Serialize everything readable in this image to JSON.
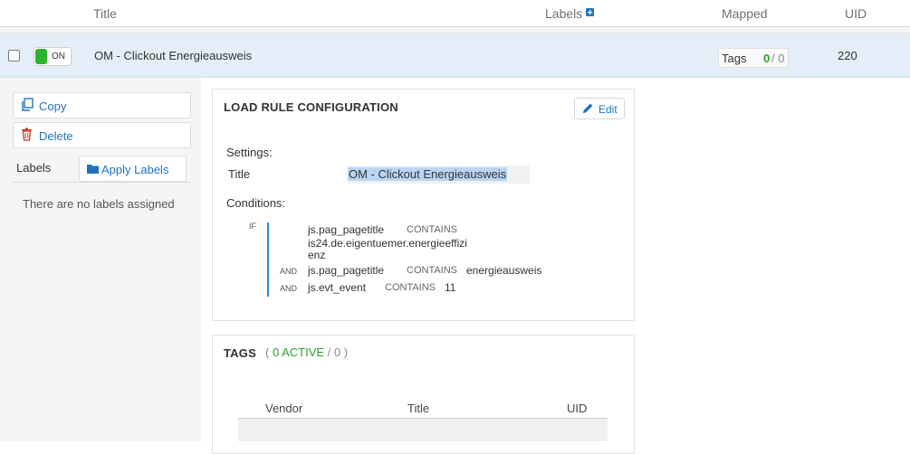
{
  "header": {
    "title_col": "Title",
    "labels_col": "Labels",
    "mapped_col": "Mapped",
    "uid_col": "UID"
  },
  "rule_row": {
    "toggle_label": "ON",
    "title": "OM - Clickout Energieausweis",
    "tags_label": "Tags",
    "tags_active": "0",
    "tags_total": "/ 0",
    "uid": "220"
  },
  "sidebar": {
    "copy_label": "Copy",
    "delete_label": "Delete",
    "labels_heading": "Labels",
    "apply_labels_label": "Apply Labels",
    "no_labels_text": "There are no labels assigned"
  },
  "config": {
    "heading": "LOAD RULE CONFIGURATION",
    "edit_label": "Edit",
    "settings_heading": "Settings:",
    "title_key": "Title",
    "title_value": "OM - Clickout Energieausweis",
    "conditions_heading": "Conditions:",
    "conditions": [
      {
        "op": "IF",
        "var": "js.pag_pagetitle",
        "cmp": "CONTAINS",
        "val": "is24.de.eigentuemer.energieeffizi",
        "val2": "enz"
      },
      {
        "op": "AND",
        "var": "js.pag_pagetitle",
        "cmp": "CONTAINS",
        "val": "energieausweis"
      },
      {
        "op": "AND",
        "var": "js.evt_event",
        "cmp": "CONTAINS",
        "val": "11"
      }
    ]
  },
  "tags_panel": {
    "heading": "TAGS",
    "open_paren": "(",
    "active_text": "0 ACTIVE",
    "total_text": "/ 0 )",
    "columns": [
      "Vendor",
      "Title",
      "UID"
    ]
  },
  "colors": {
    "accent": "#1e73be",
    "on_green": "#2cb52c",
    "selected_row": "#e4eef8",
    "condition_bar": "#2f8bd8"
  },
  "icons": {
    "labels_add": "plus-square-icon",
    "copy": "copy-icon",
    "delete": "trash-icon",
    "apply_labels": "folder-icon",
    "edit": "pencil-icon"
  }
}
